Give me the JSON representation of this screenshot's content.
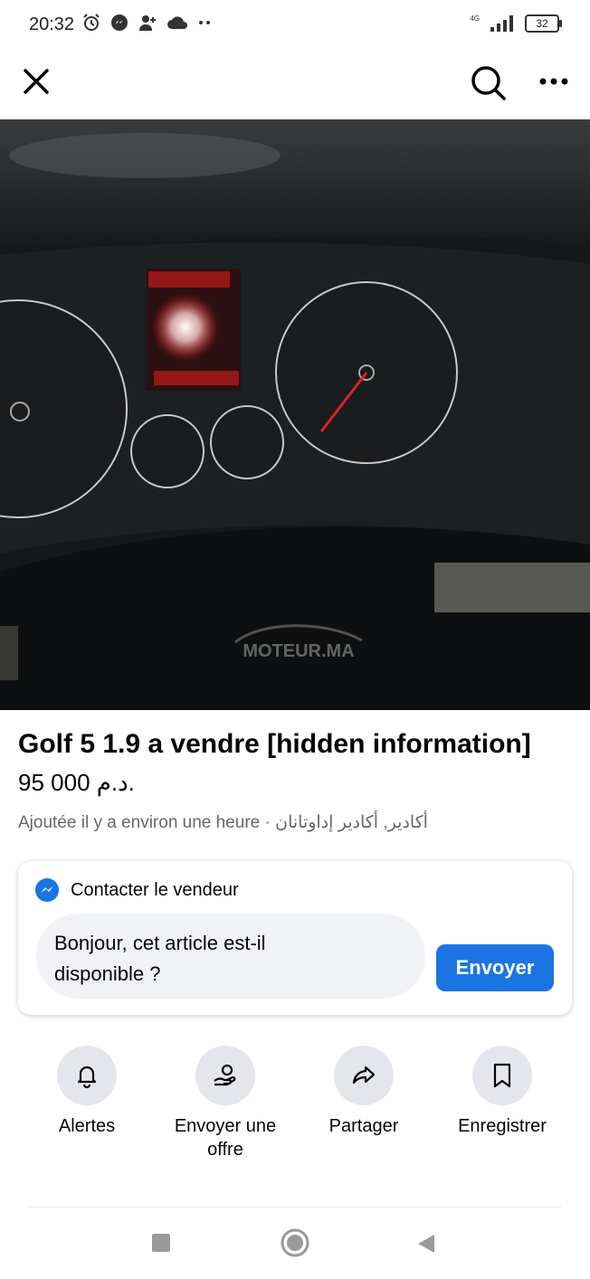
{
  "status_bar": {
    "time": "20:32",
    "network": "4G",
    "battery": "32",
    "icons": [
      "alarm-icon",
      "messenger-icon",
      "person-icon",
      "cloud-icon",
      "more-dots-icon",
      "signal-icon",
      "battery-icon"
    ]
  },
  "top_bar": {
    "icons": [
      "close-icon",
      "search-icon",
      "more-icon"
    ]
  },
  "photo": {
    "watermark": "MOTEUR.MA",
    "image_count": 8,
    "active_index": 5
  },
  "listing": {
    "title": "Golf 5 1.9 a vendre [hidden information]",
    "price": "95 000 د.م.",
    "meta": "Ajoutée il y a environ une heure · أكادير, أكادير إداوتانان"
  },
  "contact": {
    "title": "Contacter le vendeur",
    "message": "Bonjour, cet article est-il disponible ?",
    "send_label": "Envoyer"
  },
  "actions": [
    {
      "label": "Alertes",
      "icon": "bell-icon"
    },
    {
      "label": "Envoyer une offre",
      "icon": "offer-icon"
    },
    {
      "label": "Partager",
      "icon": "share-icon"
    },
    {
      "label": "Enregistrer",
      "icon": "bookmark-icon"
    }
  ],
  "colors": {
    "accent": "#1b74e4",
    "text": "#050505",
    "secondary_text": "#65676b",
    "action_bg": "#e4e6eb"
  }
}
